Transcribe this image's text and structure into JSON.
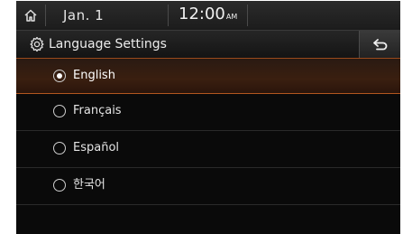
{
  "status_bar": {
    "date": "Jan.  1",
    "time": "12:00",
    "ampm": "AM"
  },
  "header": {
    "title": "Language Settings",
    "settings_icon": "gear-icon",
    "back_icon": "back-arrow-icon"
  },
  "languages": [
    {
      "label": "English",
      "selected": true
    },
    {
      "label": "Français",
      "selected": false
    },
    {
      "label": "Español",
      "selected": false
    },
    {
      "label": "한국어",
      "selected": false
    }
  ],
  "colors": {
    "background": "#0a0a0a",
    "selection_accent": "#b2561f",
    "text": "#e4e4e4"
  }
}
